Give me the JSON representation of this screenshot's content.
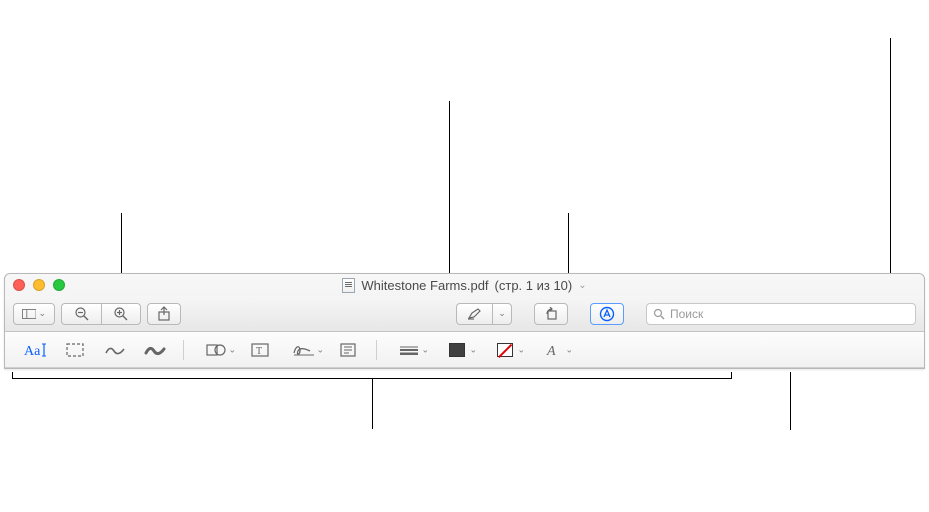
{
  "title": {
    "filename": "Whitestone Farms.pdf",
    "page_info": "(стр. 1 из 10)"
  },
  "search": {
    "placeholder": "Поиск"
  },
  "colors": {
    "accent": "#0a60ff"
  }
}
